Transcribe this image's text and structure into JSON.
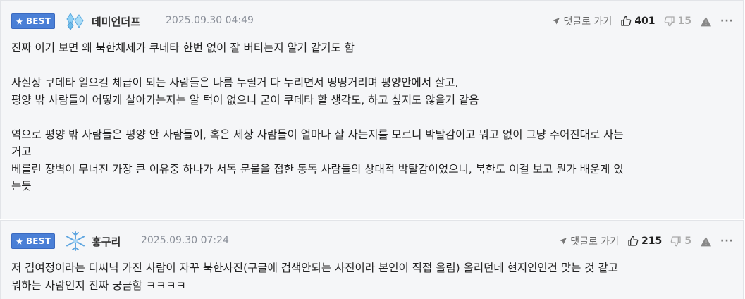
{
  "comments": [
    {
      "badge": "BEST",
      "nickname": "데미언더프",
      "date": "2025.09.30 04:49",
      "reply_label": "댓글로 가기",
      "likes": "401",
      "dislikes": "15",
      "lines": [
        "진짜 이거 보면 왜 북한체제가 쿠데타 한번 없이 잘 버티는지 알거 같기도 함",
        "",
        "사실상 쿠데타 일으킬 체급이 되는 사람들은 나름 누릴거 다 누리면서 떵떵거리며 평양안에서 살고,",
        "평양 밖 사람들이 어떻게 살아가는지는 알 턱이 없으니 굳이 쿠데타 할 생각도, 하고 싶지도 않을거 같음",
        "",
        "역으로 평양 밖 사람들은 평양 안 사람들이, 혹은 세상 사람들이 얼마나 잘 사는지를 모르니 박탈감이고 뭐고 없이 그냥 주어진대로 사는",
        "거고",
        "베를린 장벽이 무너진 가장 큰 이유중 하나가 서독 문물을 접한 동독 사람들의 상대적 박탈감이었으니, 북한도 이걸 보고 뭔가 배운게 있",
        "는듯"
      ]
    },
    {
      "badge": "BEST",
      "nickname": "홍구리",
      "date": "2025.09.30 07:24",
      "reply_label": "댓글로 가기",
      "likes": "215",
      "dislikes": "5",
      "lines": [
        "저 김여정이라는 디씨닉 가진 사람이 자꾸 북한사진(구글에 검색안되는 사진이라 본인이 직접 올림) 올리던데 현지인인건 맞는 것 같고",
        "뭐하는 사람인지 진짜 궁금함 ㅋㅋㅋㅋ"
      ]
    }
  ],
  "icons": {
    "badge_star": "star-icon",
    "avatar_1": "diamond-avatar-icon",
    "avatar_2": "snowflake-avatar-icon",
    "reply": "send-arrow-icon",
    "like": "thumbs-up-icon",
    "dislike": "thumbs-down-icon",
    "report": "warning-icon",
    "more": "more-icon"
  },
  "colors": {
    "badge_bg": "#4a7fd6",
    "comment_bg": "#f5f6f8",
    "avatar_1": "#7fc4f0",
    "avatar_2": "#6aaee8"
  }
}
